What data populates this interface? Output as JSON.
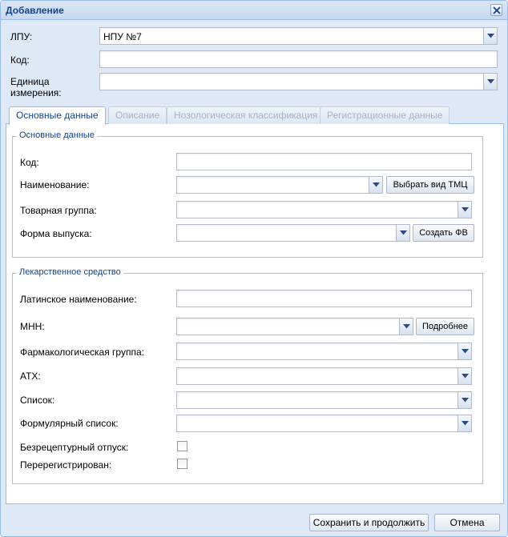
{
  "window": {
    "title": "Добавление"
  },
  "header_form": {
    "lpu_label": "ЛПУ:",
    "lpu_value": "НПУ №7",
    "code_label": "Код:",
    "code_value": "",
    "unit_label_line1": "Единица",
    "unit_label_line2": "измерения:",
    "unit_value": ""
  },
  "tabs": [
    {
      "label": "Основные данные",
      "active": true
    },
    {
      "label": "Описание",
      "active": false
    },
    {
      "label": "Нозологическая классификация",
      "active": false
    },
    {
      "label": "Регистрационные данные",
      "active": false
    }
  ],
  "main_data": {
    "legend": "Основные данные",
    "code_label": "Код:",
    "name_label": "Наименование:",
    "select_type_button": "Выбрать вид ТМЦ",
    "product_group_label": "Товарная группа:",
    "release_form_label": "Форма выпуска:",
    "create_fv_button": "Создать ФВ"
  },
  "drug": {
    "legend": "Лекарственное средство",
    "latin_name_label": "Латинское наименование:",
    "mnn_label": "МНН:",
    "details_button": "Подробнее",
    "pharm_group_label": "Фармакологическая группа:",
    "atc_label": "АТХ:",
    "list_label": "Список:",
    "formulary_label": "Формулярный список:",
    "otc_label": "Безрецептурный отпуск:",
    "otc_checked": false,
    "reregistered_label": "Перерегистрирован:",
    "reregistered_checked": false
  },
  "footer": {
    "save_continue_button": "Сохранить и продолжить",
    "cancel_button": "Отмена"
  },
  "icons": {
    "close": "close-icon",
    "dropdown": "chevron-down-icon"
  },
  "colors": {
    "title_text": "#15428b",
    "window_bg": "#dfe8f6",
    "border": "#99bbe8"
  }
}
